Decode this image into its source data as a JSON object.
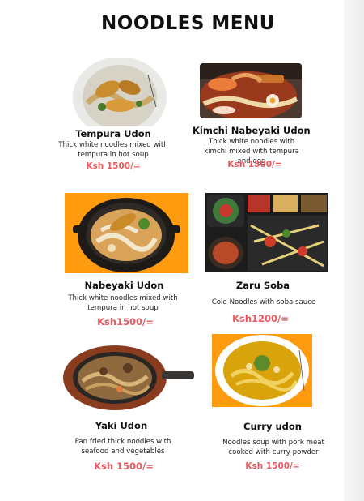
{
  "menu": {
    "title": "NOODLES MENU",
    "items": [
      {
        "name": "Tempura Udon",
        "description": "Thick white noodles mixed with tempura in hot soup",
        "price": "Ksh 1500/=",
        "image_icon": "tempura-udon-photo"
      },
      {
        "name": "Kimchi Nabeyaki Udon",
        "description": "Thick white noodles with kimchi mixed with tempura and egg",
        "price": "Ksh 1500/=",
        "image_icon": "kimchi-nabeyaki-photo"
      },
      {
        "name": "Nabeyaki Udon",
        "description": "Thick white noodles mixed with tempura in hot soup",
        "price": "Ksh1500/=",
        "image_icon": "nabeyaki-udon-photo"
      },
      {
        "name": "Zaru Soba",
        "description": "Cold Noodles with soba sauce",
        "price": "Ksh1200/=",
        "image_icon": "zaru-soba-photo"
      },
      {
        "name": "Yaki Udon",
        "description": "Pan fried thick noodles with seafood and vegetables",
        "price": "Ksh 1500/=",
        "image_icon": "yaki-udon-photo"
      },
      {
        "name": "Curry udon",
        "description": "Noodles soup with pork meat cooked with curry powder",
        "price": "Ksh 1500/=",
        "image_icon": "curry-udon-photo"
      }
    ]
  },
  "colors": {
    "price": "#e8585f",
    "orange_background": "#ff9b0f",
    "text": "#111111"
  }
}
